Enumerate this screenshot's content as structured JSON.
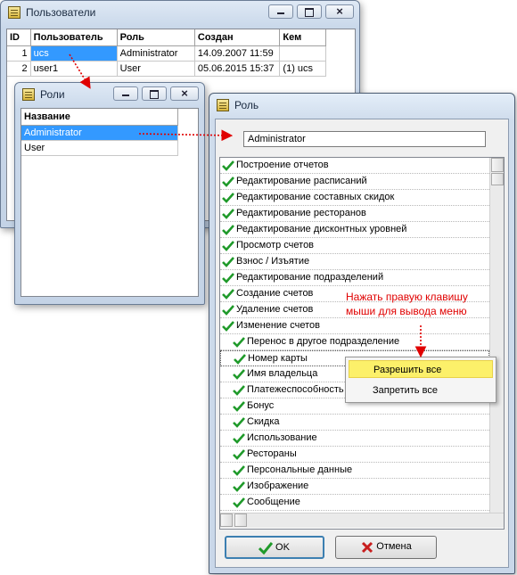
{
  "users_window": {
    "title": "Пользователи",
    "columns": [
      "ID",
      "Пользователь",
      "Роль",
      "Создан",
      "Кем"
    ],
    "rows": [
      {
        "id": "1",
        "user": "ucs",
        "role": "Administrator",
        "created": "14.09.2007 11:59",
        "by": ""
      },
      {
        "id": "2",
        "user": "user1",
        "role": "User",
        "created": "05.06.2015 15:37",
        "by": "(1) ucs"
      }
    ]
  },
  "roles_window": {
    "title": "Роли",
    "column": "Название",
    "items": [
      "Administrator",
      "User"
    ]
  },
  "role_window": {
    "title": "Роль",
    "name_value": "Administrator",
    "permissions": [
      {
        "label": "Построение отчетов",
        "checked": true,
        "indent": 0
      },
      {
        "label": "Редактирование расписаний",
        "checked": true,
        "indent": 0
      },
      {
        "label": "Редактирование составных скидок",
        "checked": true,
        "indent": 0
      },
      {
        "label": "Редактирование ресторанов",
        "checked": true,
        "indent": 0
      },
      {
        "label": "Редактирование дисконтных уровней",
        "checked": true,
        "indent": 0
      },
      {
        "label": "Просмотр счетов",
        "checked": true,
        "indent": 0
      },
      {
        "label": "Взнос / Изъятие",
        "checked": true,
        "indent": 0
      },
      {
        "label": "Редактирование подразделений",
        "checked": true,
        "indent": 0
      },
      {
        "label": "Создание счетов",
        "checked": true,
        "indent": 0
      },
      {
        "label": "Удаление счетов",
        "checked": true,
        "indent": 0
      },
      {
        "label": "Изменение счетов",
        "checked": true,
        "indent": 0
      },
      {
        "label": "Перенос в другое подразделение",
        "checked": true,
        "indent": 1
      },
      {
        "label": "Номер карты",
        "checked": true,
        "indent": 1
      },
      {
        "label": "Имя владельца",
        "checked": true,
        "indent": 1
      },
      {
        "label": "Платежеспособность",
        "checked": true,
        "indent": 1
      },
      {
        "label": "Бонус",
        "checked": true,
        "indent": 1
      },
      {
        "label": "Скидка",
        "checked": true,
        "indent": 1
      },
      {
        "label": "Использование",
        "checked": true,
        "indent": 1
      },
      {
        "label": "Рестораны",
        "checked": true,
        "indent": 1
      },
      {
        "label": "Персональные данные",
        "checked": true,
        "indent": 1
      },
      {
        "label": "Изображение",
        "checked": true,
        "indent": 1
      },
      {
        "label": "Сообщение",
        "checked": true,
        "indent": 1
      }
    ],
    "ok_label": "OK",
    "cancel_label": "Отмена"
  },
  "context_menu": {
    "items": [
      "Разрешить все",
      "Запретить все"
    ],
    "highlighted": "Разрешить все"
  },
  "annotation": {
    "line1": "Нажать правую клавишу",
    "line2": "мыши для вывода меню"
  },
  "colors": {
    "selection": "#3399ff",
    "check": "#1f9a2a",
    "annotation": "#e00000",
    "menu_highlight": "#fcf06a",
    "cancel_x": "#c81e1e"
  }
}
